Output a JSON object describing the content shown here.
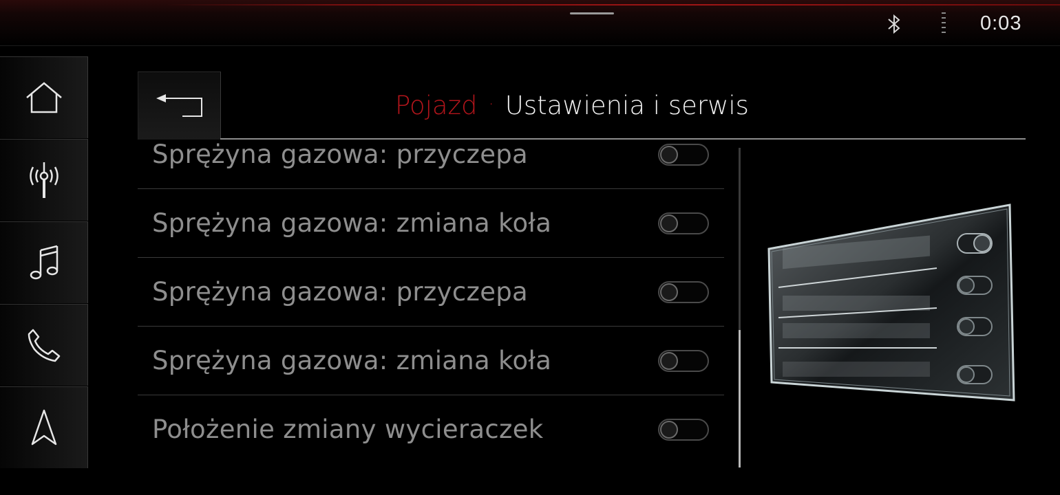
{
  "status_bar": {
    "time": "0:03",
    "icons": [
      "bluetooth-icon",
      "signal-strength-icon"
    ]
  },
  "sidebar": {
    "items": [
      {
        "name": "home",
        "icon": "home-icon"
      },
      {
        "name": "radio",
        "icon": "radio-antenna-icon"
      },
      {
        "name": "media",
        "icon": "music-note-icon"
      },
      {
        "name": "phone",
        "icon": "phone-icon"
      },
      {
        "name": "navigation",
        "icon": "navigation-arrow-icon"
      }
    ]
  },
  "header": {
    "back_icon": "back-arrow-icon",
    "breadcrumb_parent": "Pojazd",
    "breadcrumb_separator": "·",
    "title": "Ustawienia i serwis"
  },
  "list": {
    "items": [
      {
        "label": "Sprężyna gazowa: przyczepa",
        "enabled": false
      },
      {
        "label": "Sprężyna gazowa: zmiana koła",
        "enabled": false
      },
      {
        "label": "Sprężyna gazowa: przyczepa",
        "enabled": false
      },
      {
        "label": "Sprężyna gazowa: zmiana koła",
        "enabled": false
      },
      {
        "label": "Położenie zmiany wycieraczek",
        "enabled": false
      }
    ]
  },
  "colors": {
    "accent": "#b3151b",
    "background": "#000000",
    "text_muted": "#8e8e8e",
    "text_primary": "#f2f2f2"
  }
}
